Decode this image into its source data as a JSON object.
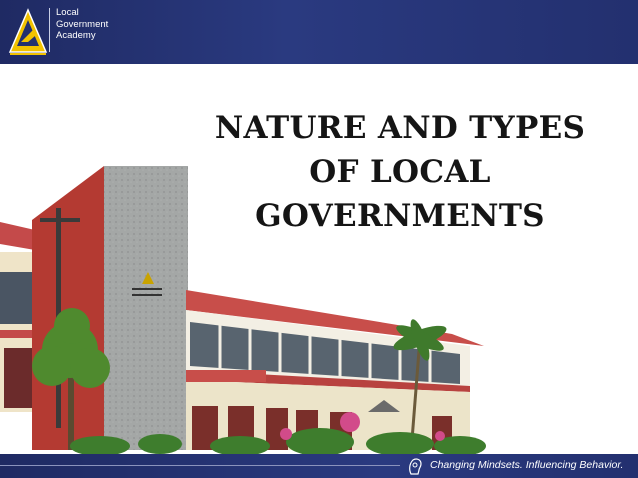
{
  "header": {
    "org_line1": "Local",
    "org_line2": "Government",
    "org_line3": "Academy",
    "logo_icon": "lga-triangle-logo-icon"
  },
  "title": {
    "line1": "NATURE AND TYPES",
    "line2": "OF LOCAL",
    "line3": "GOVERNMENTS"
  },
  "illustration": {
    "name": "lga-building-photo"
  },
  "footer": {
    "tagline": "Changing Mindsets. Influencing Behavior.",
    "icon": "thinker-head-icon"
  },
  "colors": {
    "brand_navy": "#23306f",
    "roof_red": "#c44a4a",
    "title_text": "#151515"
  }
}
